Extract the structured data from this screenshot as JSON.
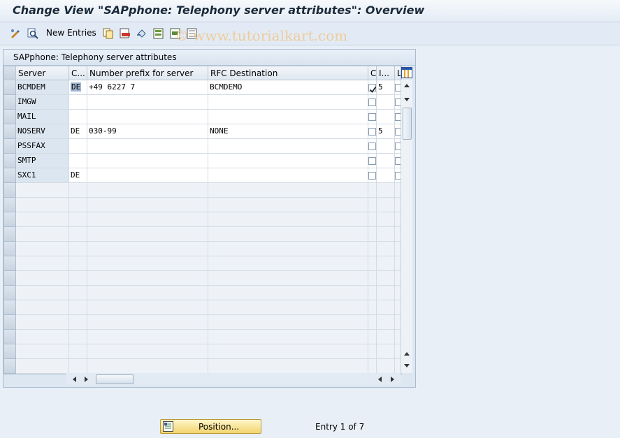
{
  "window": {
    "title": "Change View \"SAPphone: Telephony server attributes\": Overview"
  },
  "toolbar": {
    "new_entries_label": "New Entries"
  },
  "watermark": "© www.tutorialkart.com",
  "panel": {
    "title": "SAPphone: Telephony server attributes"
  },
  "table": {
    "columns": [
      "Server",
      "C...",
      "Number prefix for server",
      "RFC Destination",
      "C",
      "I...",
      "L"
    ],
    "rows": [
      {
        "server": "BCMDEM",
        "c": "DE",
        "prefix": "+49 6227 7",
        "rfc": "BCMDEMO",
        "checked": true,
        "i": "5"
      },
      {
        "server": "IMGW",
        "c": "",
        "prefix": "",
        "rfc": "",
        "checked": false,
        "i": ""
      },
      {
        "server": "MAIL",
        "c": "",
        "prefix": "",
        "rfc": "",
        "checked": false,
        "i": ""
      },
      {
        "server": "NOSERV",
        "c": "DE",
        "prefix": "030-99",
        "rfc": "NONE",
        "checked": false,
        "i": "5"
      },
      {
        "server": "PSSFAX",
        "c": "",
        "prefix": "",
        "rfc": "",
        "checked": false,
        "i": ""
      },
      {
        "server": "SMTP",
        "c": "",
        "prefix": "",
        "rfc": "",
        "checked": false,
        "i": ""
      },
      {
        "server": "SXC1",
        "c": "DE",
        "prefix": "",
        "rfc": "",
        "checked": false,
        "i": ""
      }
    ]
  },
  "footer": {
    "position_label": "Position...",
    "entry_text": "Entry 1 of 7"
  },
  "colors": {
    "position_button": "#f2d570",
    "key_cell": "#dbe6f1",
    "title_text": "#1a2a3a"
  }
}
